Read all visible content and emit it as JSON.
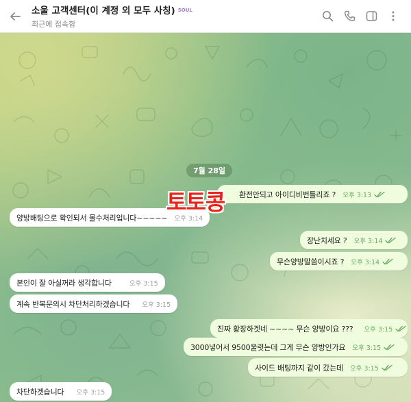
{
  "header": {
    "title": "소울 고객센터(이 계정 외 모두 사칭)",
    "badge": "SOUL",
    "subtitle": "최근에 접속함"
  },
  "date_label": "7월 28일",
  "watermark": "토토콩",
  "messages": [
    {
      "side": "out",
      "text": "환전안되고 아이디비번틀리죠 ?",
      "time": "오후 3:13"
    },
    {
      "side": "in",
      "text": "양방배팅으로 확인되서 몰수처리입니다~~~~~",
      "time": "오후 3:14"
    },
    {
      "side": "out",
      "text": "장난치세요 ?",
      "time": "오후 3:14"
    },
    {
      "side": "out",
      "text": "무슨양방말씀이시죠 ?",
      "time": "오후 3:14"
    },
    {
      "side": "in",
      "text": "본인이 잘 아실꺼라 생각합니다",
      "time": "오후 3:15"
    },
    {
      "side": "in",
      "text": "계속 반복문의시 차단처리하겠습니다",
      "time": "오후 3:15"
    },
    {
      "side": "out",
      "text": "진짜 황장하겟네 ~~~~ 무슨 양방이요 ???",
      "time": "오후 3:15"
    },
    {
      "side": "out",
      "text": "3000넣어서 9500울렷는데 그게 무슨 양방인가요",
      "time": "오후 3:15"
    },
    {
      "side": "out",
      "text": "사이드 배팅까지 같이 갔는데",
      "time": "오후 3:15"
    },
    {
      "side": "in",
      "text": "차단하겟습니다",
      "time": "오후 3:15"
    }
  ],
  "colors": {
    "incoming_bubble": "#ffffff",
    "outgoing_bubble": "#effdde",
    "read_ticks": "#6aaa5e",
    "watermark": "#e8231c"
  },
  "icons": [
    "back-arrow-icon",
    "search-icon",
    "phone-icon",
    "sidebar-icon",
    "more-icon",
    "double-check-icon"
  ]
}
